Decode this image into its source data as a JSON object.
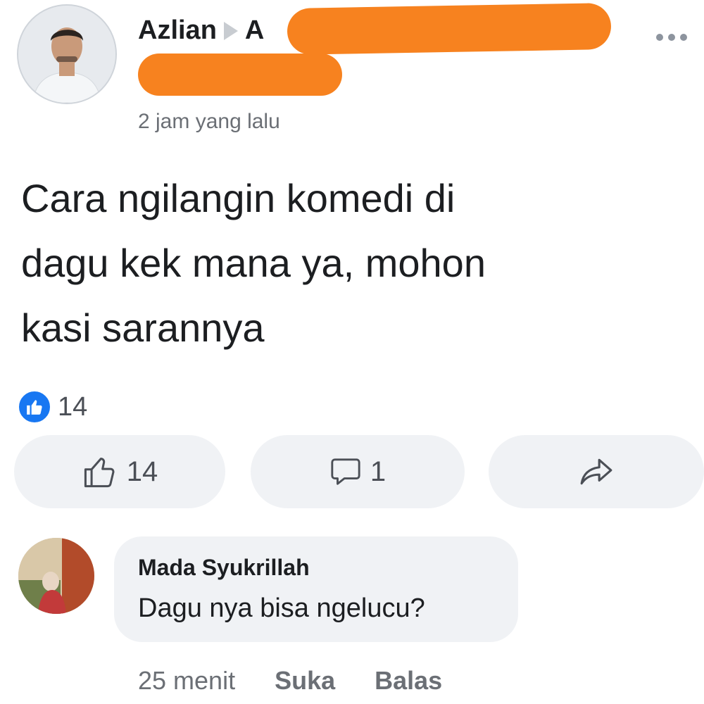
{
  "post": {
    "author_name": "Azlian",
    "target_name_visible": "A",
    "timestamp": "2 jam yang lalu",
    "text": "Cara ngilangin komedi di\ndagu kek mana ya, mohon\nkasi sarannya",
    "reaction_count": "14",
    "actions": {
      "like_count": "14",
      "comment_count": "1"
    }
  },
  "comment": {
    "author": "Mada Syukrillah",
    "text": "Dagu nya bisa ngelucu?",
    "time": "25 menit",
    "like_label": "Suka",
    "reply_label": "Balas"
  },
  "colors": {
    "redaction": "#f7821f",
    "like_blue": "#1877f2",
    "button_bg": "#f0f2f5"
  }
}
